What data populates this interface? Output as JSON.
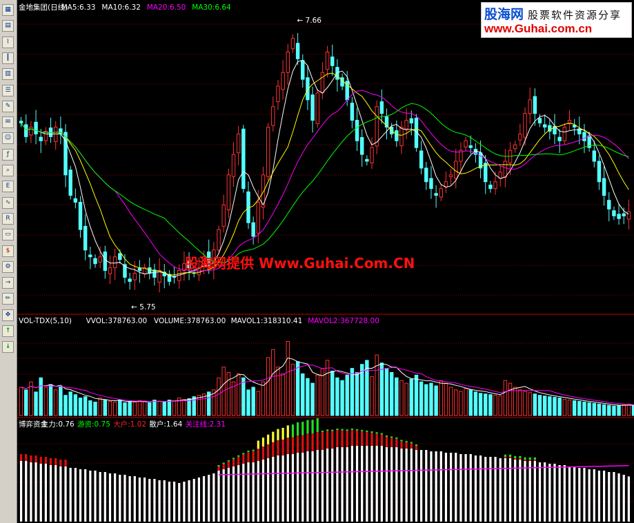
{
  "logo": {
    "brand": "股海网",
    "slogan": "股票软件资源分享",
    "url": "www.Guhai.com.cn"
  },
  "watermark": "股海网提供 Www.Guhai.Com.CN",
  "toolbar_icons": [
    "table-icon",
    "grid-icon",
    "line-chart-icon",
    "candle-chart-icon",
    "report-icon",
    "list-icon",
    "notes-icon",
    "mail-icon",
    "users-icon",
    "formula-icon",
    "zoom-icon",
    "etf-icon",
    "wave-icon",
    "rsi-icon",
    "window-icon",
    "dollar-icon",
    "wrench-icon",
    "import-icon",
    "pencil-icon",
    "move-icon",
    "up-arrow-icon",
    "down-arrow-icon"
  ],
  "colors": {
    "up": "#ff3232",
    "down": "#54ffff",
    "ma5": "#ffffff",
    "ma10": "#ffff00",
    "ma20": "#ff00ff",
    "ma30": "#00ff00",
    "grid": "#8b0000"
  },
  "chart_data": [
    {
      "type": "candlestick",
      "title": "金地集团(日线)",
      "legend": [
        {
          "text": "MA5:6.33",
          "color": "#ffffff"
        },
        {
          "text": "MA10:6.32",
          "color": "#ffffff"
        },
        {
          "text": "MA20:6.50",
          "color": "#ff00ff"
        },
        {
          "text": "MA30:6.64",
          "color": "#00ff00"
        }
      ],
      "high_label": "7.66",
      "low_label": "5.75",
      "ylim": [
        5.6,
        7.78
      ],
      "closes": [
        6.98,
        6.88,
        6.95,
        6.9,
        6.85,
        6.92,
        6.88,
        6.95,
        6.9,
        6.6,
        6.45,
        6.4,
        6.2,
        6.05,
        6.0,
        5.95,
        6.0,
        5.9,
        5.92,
        6.0,
        5.98,
        5.85,
        5.82,
        5.88,
        5.9,
        5.92,
        5.88,
        5.85,
        5.9,
        5.86,
        5.82,
        5.85,
        5.9,
        5.95,
        5.92,
        5.88,
        5.92,
        6.0,
        5.95,
        6.05,
        6.2,
        6.38,
        6.6,
        6.75,
        6.9,
        6.5,
        6.25,
        6.15,
        6.4,
        6.6,
        6.95,
        7.1,
        7.25,
        7.35,
        7.5,
        7.6,
        7.45,
        7.3,
        7.15,
        7.0,
        7.2,
        7.35,
        7.5,
        7.4,
        7.3,
        7.25,
        7.15,
        7.0,
        6.85,
        6.75,
        6.7,
        6.8,
        7.1,
        7.05,
        6.95,
        6.9,
        6.85,
        6.95,
        7.0,
        6.98,
        6.8,
        6.65,
        6.55,
        6.5,
        6.45,
        6.5,
        6.55,
        6.6,
        6.7,
        6.78,
        6.85,
        6.8,
        6.75,
        6.65,
        6.55,
        6.5,
        6.55,
        6.62,
        6.7,
        6.78,
        6.82,
        6.9,
        7.05,
        7.15,
        7.05,
        6.98,
        6.95,
        6.92,
        6.9,
        6.85,
        6.95,
        7.0,
        6.95,
        6.9,
        6.85,
        6.8,
        6.7,
        6.55,
        6.45,
        6.35,
        6.3,
        6.28,
        6.3,
        6.33
      ]
    },
    {
      "type": "bar",
      "title": "VOL-TDX(5,10)",
      "legend": [
        {
          "text": "VVOL:378763.00",
          "color": "#ffffff"
        },
        {
          "text": "VOLUME:378763.00",
          "color": "#ffffff"
        },
        {
          "text": "MAVOL1:318310.41",
          "color": "#ffffff"
        },
        {
          "text": "MAVOL2:367728.00",
          "color": "#ff00ff"
        }
      ],
      "ylim": [
        0,
        1300000
      ],
      "values": [
        420000,
        380000,
        500000,
        350000,
        560000,
        420000,
        460000,
        380000,
        430000,
        300000,
        350000,
        310000,
        260000,
        280000,
        220000,
        200000,
        260000,
        230000,
        210000,
        200000,
        230000,
        190000,
        210000,
        200000,
        220000,
        210000,
        190000,
        230000,
        210000,
        200000,
        230000,
        210000,
        260000,
        240000,
        250000,
        280000,
        300000,
        320000,
        350000,
        380000,
        560000,
        720000,
        640000,
        500000,
        620000,
        560000,
        380000,
        420000,
        360000,
        500000,
        860000,
        980000,
        720000,
        620000,
        1100000,
        760000,
        800000,
        620000,
        550000,
        480000,
        600000,
        700000,
        820000,
        660000,
        560000,
        520000,
        600000,
        700000,
        640000,
        760000,
        820000,
        580000,
        900000,
        780000,
        700000,
        640000,
        560000,
        520000,
        480000,
        540000,
        600000,
        500000,
        460000,
        480000,
        440000,
        520000,
        480000,
        420000,
        380000,
        360000,
        400000,
        380000,
        350000,
        330000,
        320000,
        310000,
        300000,
        290000,
        520000,
        480000,
        420000,
        380000,
        360000,
        340000,
        320000,
        300000,
        290000,
        280000,
        270000,
        260000,
        240000,
        230000,
        220000,
        210000,
        200000,
        190000,
        180000,
        170000,
        160000,
        150000,
        140000,
        150000,
        160000,
        170000,
        150000
      ]
    },
    {
      "type": "bar",
      "title": "博弈资金",
      "legend": [
        {
          "text": "主力:0.76",
          "color": "#ffffff"
        },
        {
          "text": "游资:0.75",
          "color": "#00ff00"
        },
        {
          "text": "大户:1.02",
          "color": "#ff2020"
        },
        {
          "text": "散户:1.64",
          "color": "#ffffff"
        },
        {
          "text": "关注线:2.31",
          "color": "#ff00ff"
        }
      ],
      "ylim": [
        0,
        3.3
      ],
      "values": [
        2.2,
        2.2,
        2.15,
        2.15,
        2.1,
        2.1,
        2.05,
        2.05,
        2.0,
        2.0,
        1.95,
        1.95,
        1.9,
        1.9,
        1.85,
        1.85,
        1.8,
        1.8,
        1.75,
        1.75,
        1.7,
        1.7,
        1.65,
        1.65,
        1.6,
        1.6,
        1.55,
        1.55,
        1.5,
        1.5,
        1.45,
        1.45,
        1.4,
        1.45,
        1.5,
        1.55,
        1.6,
        1.65,
        1.7,
        1.75,
        1.85,
        1.9,
        1.95,
        2.0,
        2.05,
        2.1,
        2.15,
        2.15,
        2.2,
        2.25,
        2.3,
        2.35,
        2.4,
        2.4,
        2.45,
        2.45,
        2.5,
        2.5,
        2.55,
        2.55,
        2.6,
        2.6,
        2.65,
        2.65,
        2.7,
        2.7,
        2.7,
        2.75,
        2.75,
        2.75,
        2.75,
        2.75,
        2.75,
        2.75,
        2.7,
        2.7,
        2.7,
        2.65,
        2.65,
        2.65,
        2.6,
        2.6,
        2.6,
        2.55,
        2.55,
        2.55,
        2.5,
        2.5,
        2.5,
        2.45,
        2.45,
        2.45,
        2.4,
        2.4,
        2.35,
        2.35,
        2.35,
        2.3,
        2.3,
        2.3,
        2.25,
        2.25,
        2.2,
        2.2,
        2.2,
        2.15,
        2.15,
        2.1,
        2.1,
        2.05,
        2.05,
        2.0,
        2.0,
        1.95,
        1.95,
        1.9,
        1.9,
        1.85,
        1.85,
        1.8,
        1.8,
        1.75,
        1.7,
        1.64
      ]
    }
  ]
}
